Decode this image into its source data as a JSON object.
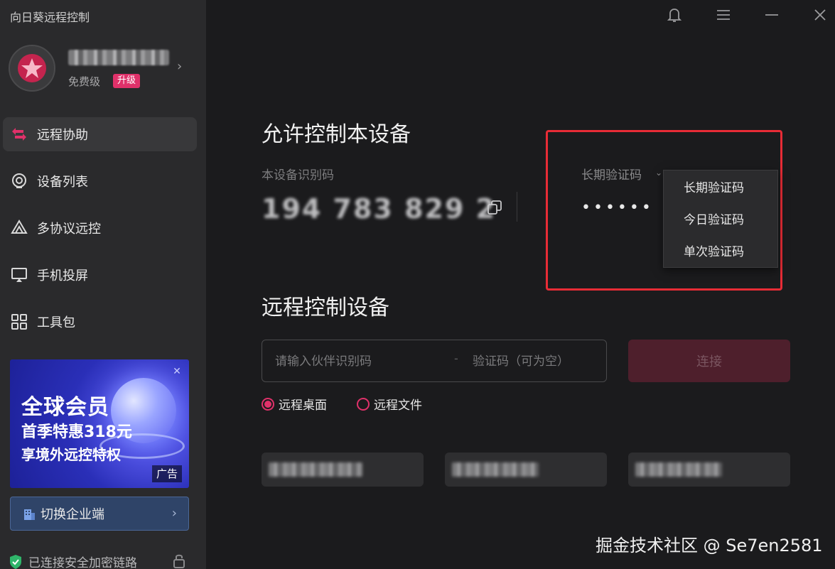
{
  "app": {
    "title": "向日葵远程控制"
  },
  "user": {
    "tier": "免费级",
    "upgrade_label": "升级"
  },
  "sidebar": {
    "items": [
      {
        "label": "远程协助",
        "icon": "remote-assist-icon"
      },
      {
        "label": "设备列表",
        "icon": "device-list-icon"
      },
      {
        "label": "多协议远控",
        "icon": "multi-protocol-icon"
      },
      {
        "label": "手机投屏",
        "icon": "screen-mirror-icon"
      },
      {
        "label": "工具包",
        "icon": "toolkit-icon"
      }
    ],
    "ad": {
      "line1": "全球会员",
      "line2": "首季特惠318元",
      "line3": "享境外远控特权",
      "tag": "广告"
    },
    "switch_label": "切换企业端",
    "secure_text": "已连接安全加密链路"
  },
  "allow": {
    "title": "允许控制本设备",
    "device_id_label": "本设备识别码",
    "device_id": "194 783 829 2",
    "code_type": "长期验证码",
    "code_value": "••••••",
    "dropdown": [
      "长期验证码",
      "今日验证码",
      "单次验证码"
    ]
  },
  "remote": {
    "title": "远程控制设备",
    "partner_placeholder": "请输入伙伴识别码",
    "separator": "-",
    "code_placeholder": "验证码（可为空）",
    "connect_label": "连接",
    "modes": [
      {
        "label": "远程桌面",
        "checked": true
      },
      {
        "label": "远程文件",
        "checked": false
      }
    ]
  },
  "watermark": "掘金技术社区 @ Se7en2581",
  "colors": {
    "accent": "#e0316a",
    "highlight": "#e82c36",
    "sidebar": "#2a2a2c",
    "main": "#1b1b1d"
  }
}
